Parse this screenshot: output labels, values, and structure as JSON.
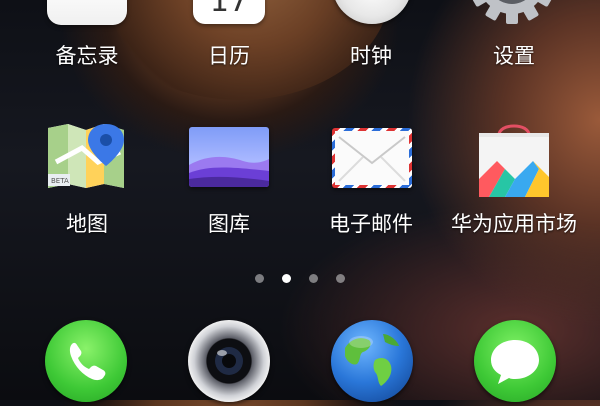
{
  "home_screen": {
    "row1": [
      {
        "label": "备忘录",
        "icon": "notes-icon"
      },
      {
        "label": "日历",
        "icon": "calendar-icon",
        "date": "17"
      },
      {
        "label": "时钟",
        "icon": "clock-icon"
      },
      {
        "label": "设置",
        "icon": "gear-icon"
      }
    ],
    "row2": [
      {
        "label": "地图",
        "icon": "maps-icon",
        "badge": "BETA"
      },
      {
        "label": "图库",
        "icon": "gallery-icon"
      },
      {
        "label": "电子邮件",
        "icon": "mail-icon"
      },
      {
        "label": "华为应用市场",
        "icon": "app-store-icon"
      }
    ],
    "page_indicator": {
      "pages": 4,
      "active": 2
    },
    "dock": [
      {
        "icon": "phone-icon"
      },
      {
        "icon": "camera-icon"
      },
      {
        "icon": "browser-globe-icon"
      },
      {
        "icon": "messages-icon"
      }
    ]
  },
  "colors": {
    "label_text": "#ffffff",
    "phone_green": "#3ec936",
    "maps_pin_blue": "#3b78e7",
    "gallery_purple": "#6b3fd6"
  }
}
